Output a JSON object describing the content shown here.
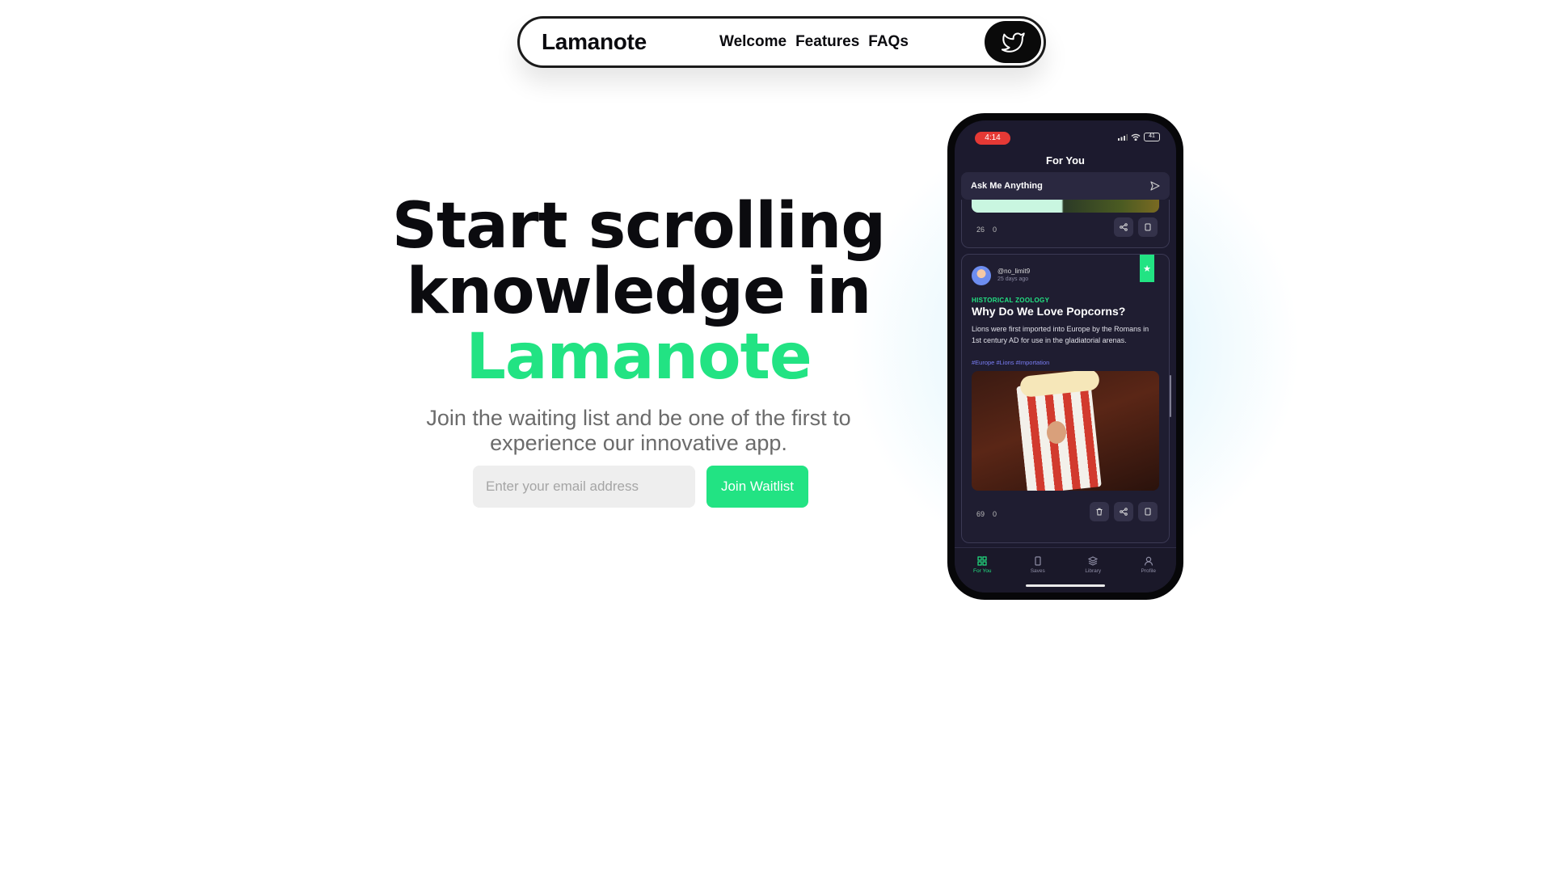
{
  "nav": {
    "brand": "Lamanote",
    "links": [
      "Welcome",
      "Features",
      "FAQs"
    ],
    "social_icon": "twitter-icon"
  },
  "hero": {
    "title_line1": "Start scrolling",
    "title_line2": "knowledge in",
    "title_accent": "Lamanote",
    "subtitle": "Join the waiting list and be one of the first to experience our innovative app.",
    "email_placeholder": "Enter your email address",
    "email_value": "",
    "join_label": "Join Waitlist",
    "accent_color": "#22e383"
  },
  "phone": {
    "status_time": "4:14",
    "battery": "41",
    "screen_title": "For You",
    "ask_label": "Ask Me Anything",
    "card1": {
      "likes": "26",
      "saves": "0"
    },
    "card2": {
      "handle": "@no_limit9",
      "time": "25 days ago",
      "category": "HISTORICAL ZOOLOGY",
      "title": "Why Do We Love Popcorns?",
      "body": "Lions were first imported into Europe by the Romans in 1st century AD for use in the gladiatorial arenas.",
      "tags": "#Europe #Lions #Importation",
      "likes": "69",
      "saves": "0"
    },
    "tabs": [
      "For You",
      "Saves",
      "Library",
      "Profile"
    ]
  }
}
